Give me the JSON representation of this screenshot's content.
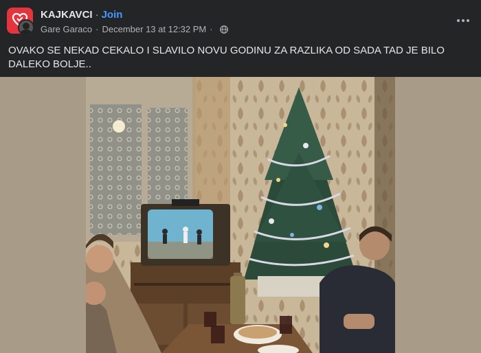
{
  "post": {
    "group_name": "KAJKAVCI",
    "separator": "·",
    "join_label": "Join",
    "author": "Gare Garaco",
    "date": "December 13 at 12:32 PM",
    "text": "OVAKO SE NEKAD CEKALO I SLAVILO NOVU GODINU ZA RAZLIKA OD SADA TAD JE BILO DALEKO BOLJE..",
    "privacy_icon": "globe-icon",
    "menu_icon": "more-horizontal-icon",
    "group_avatar_icon": "heart-logo",
    "photo_description_icons": [
      "christmas-tree",
      "television"
    ]
  },
  "colors": {
    "background": "#242526",
    "text_primary": "#e4e6eb",
    "text_secondary": "#b0b3b8",
    "link": "#4599ff",
    "group_avatar": "#e4343d"
  }
}
